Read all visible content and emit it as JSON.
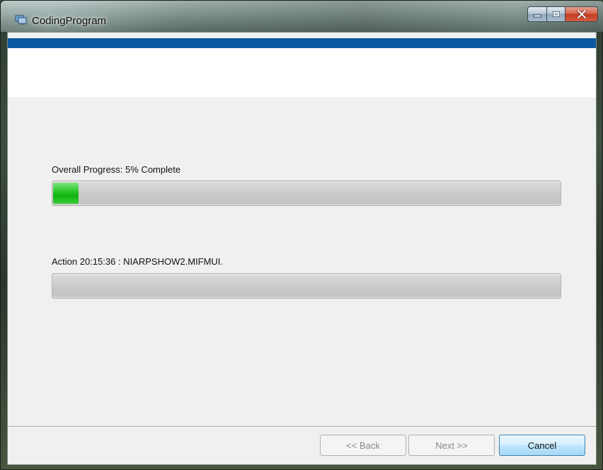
{
  "window": {
    "title": "CodingProgram",
    "icon": "installer-app-icon"
  },
  "caption_buttons": {
    "minimize_icon": "minimize-icon",
    "maximize_icon": "maximize-icon",
    "close_icon": "close-icon"
  },
  "progress": {
    "overall_label": "Overall Progress: 5% Complete",
    "overall_percent": 5,
    "action_label": "Action 20:15:36 : NIARPSHOW2.MIFMUI.",
    "action_percent": 0,
    "fill_color": "#1fbd1f"
  },
  "banner": {
    "stripe_color": "#0a58a0"
  },
  "buttons": {
    "back_label": "<< Back",
    "next_label": "Next >>",
    "cancel_label": "Cancel"
  }
}
